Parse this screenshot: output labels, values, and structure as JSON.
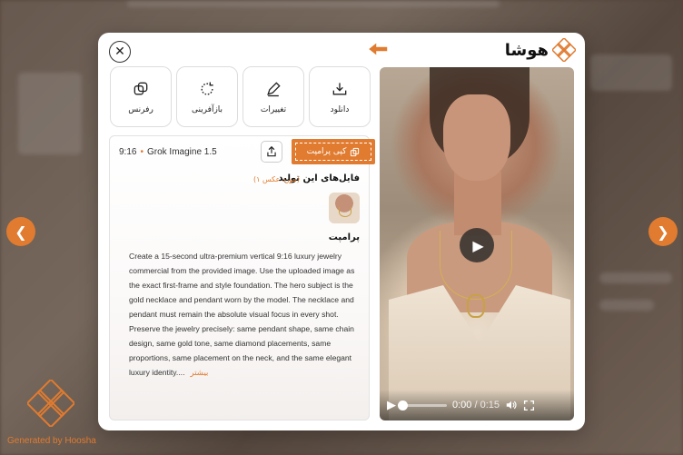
{
  "modal": {
    "logo_text": "هوشا",
    "close_symbol": "✕"
  },
  "actions": [
    {
      "label": "دانلود",
      "icon": "download-icon"
    },
    {
      "label": "تغییرات",
      "icon": "edit-pencil-icon"
    },
    {
      "label": "بازآفرینی",
      "icon": "regenerate-icon"
    },
    {
      "label": "رفرنس",
      "icon": "reference-copy-icon"
    }
  ],
  "info": {
    "ratio": "9:16",
    "model": "Grok Imagine 1.5",
    "copy_prompt_label": "کپی پرامپت",
    "files_title": "فایل‌های این تولید",
    "files_count": "(۱ مورد عکس)",
    "prompt_title": "پرامپت",
    "prompt_text": "Create a 15-second ultra-premium vertical 9:16 luxury jewelry commercial from the provided image. Use the uploaded image as the exact first-frame and style foundation. The hero subject is the gold necklace and pendant worn by the model. The necklace and pendant must remain the absolute visual focus in every shot. Preserve the jewelry precisely: same pendant shape, same chain design, same gold tone, same diamond placements, same proportions, same placement on the neck, and the same elegant luxury identity....",
    "more_label": "بیشتر"
  },
  "video": {
    "current_time": "0:00",
    "separator": "/",
    "duration": "0:15",
    "progress": 0
  },
  "watermark": {
    "text": "Generated by Hoosha"
  },
  "colors": {
    "accent": "#e07b30"
  }
}
